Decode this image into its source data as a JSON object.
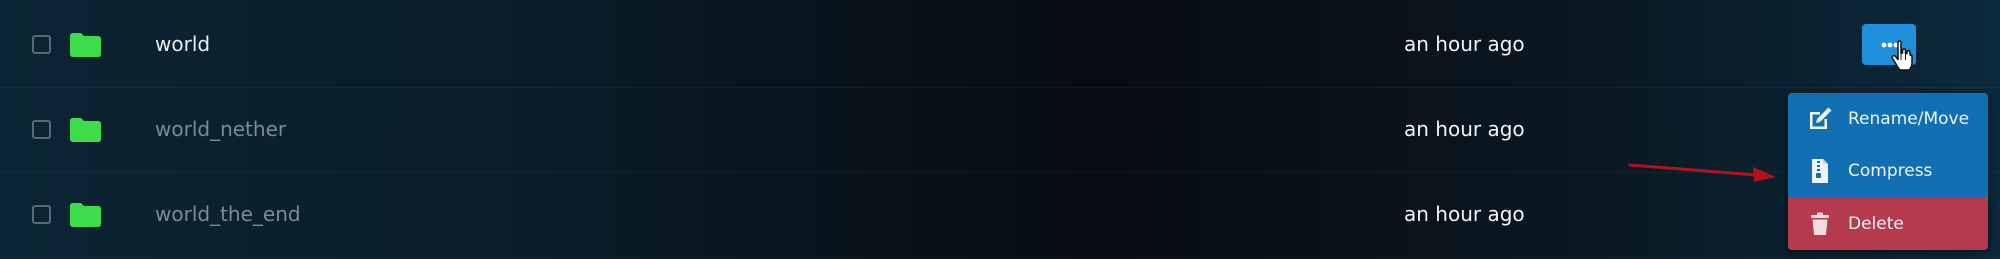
{
  "files": [
    {
      "name": "world",
      "modified": "an hour ago"
    },
    {
      "name": "world_nether",
      "modified": "an hour ago"
    },
    {
      "name": "world_the_end",
      "modified": "an hour ago"
    }
  ],
  "context_menu": {
    "items": [
      {
        "label": "Rename/Move",
        "icon": "edit-icon"
      },
      {
        "label": "Compress",
        "icon": "archive-icon"
      },
      {
        "label": "Delete",
        "icon": "trash-icon"
      }
    ]
  },
  "colors": {
    "folder": "#3ddc4a",
    "action_button": "#1e90db",
    "menu_bg": "#126fb1",
    "delete_bg": "#b53a4e",
    "annotation_arrow": "#b3121b"
  }
}
